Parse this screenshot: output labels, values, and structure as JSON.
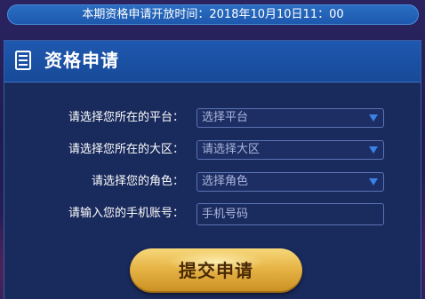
{
  "notice": {
    "prefix": "本期资格申请开放时间：",
    "time": "2018年10月10日11：00"
  },
  "panel": {
    "title": "资格申请",
    "icon": "document-list-icon"
  },
  "form": {
    "platform": {
      "label": "请选择您所在的平台：",
      "selected": "选择平台"
    },
    "region": {
      "label": "请选择您所在的大区：",
      "selected": "请选择大区"
    },
    "role": {
      "label": "请选择您的角色：",
      "selected": "选择角色"
    },
    "phone": {
      "label": "请输入您的手机账号：",
      "placeholder": "手机号码",
      "value": ""
    }
  },
  "submit": {
    "label": "提交申请"
  },
  "colors": {
    "notice_bg": "#1d58ad",
    "header_bg": "#1f58b0",
    "panel_bg": "#192a5c",
    "arrow": "#3a82e8",
    "button_gold": "#e7b446",
    "button_text": "#4a2a06"
  }
}
